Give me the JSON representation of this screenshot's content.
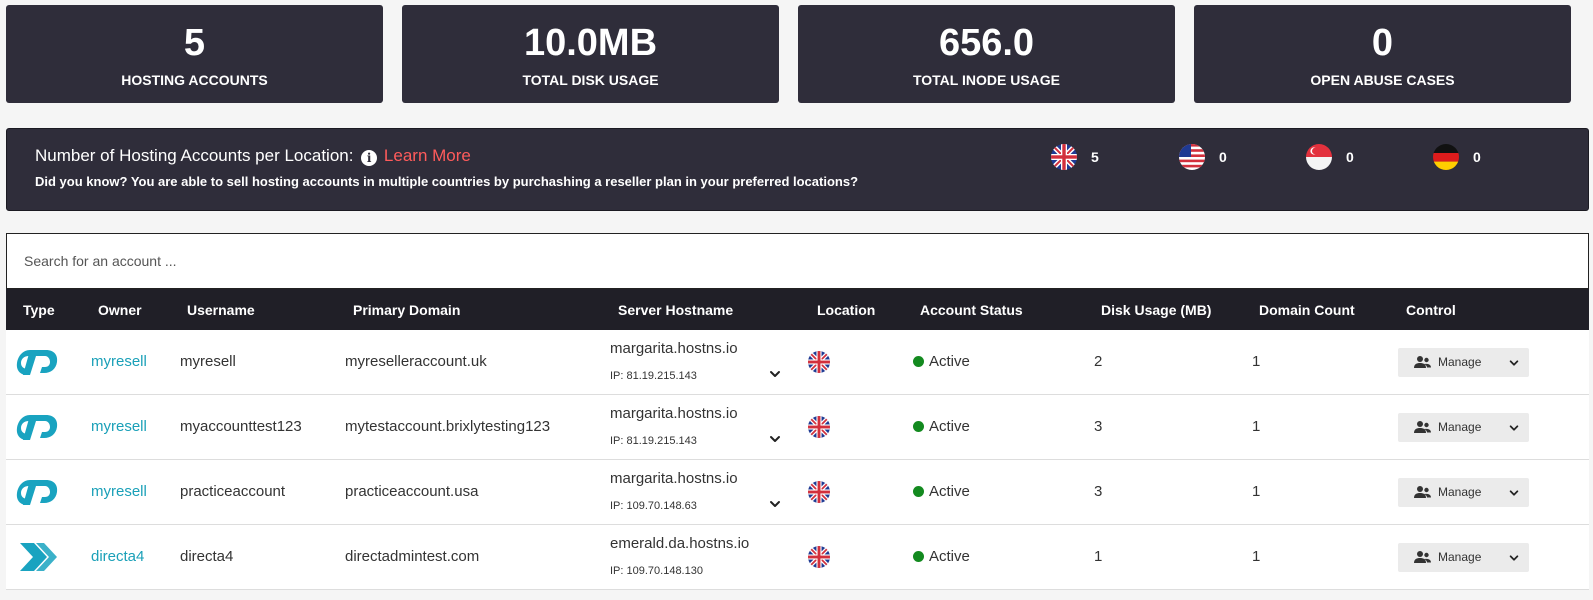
{
  "stats": [
    {
      "value": "5",
      "label": "HOSTING ACCOUNTS"
    },
    {
      "value": "10.0MB",
      "label": "TOTAL DISK USAGE"
    },
    {
      "value": "656.0",
      "label": "TOTAL INODE USAGE"
    },
    {
      "value": "0",
      "label": "OPEN ABUSE CASES"
    }
  ],
  "locations": {
    "title": "Number of Hosting Accounts per Location:",
    "learn_more": "Learn More",
    "subtitle": "Did you know? You are able to sell hosting accounts in multiple countries by purchashing a reseller plan in your preferred locations?",
    "flags": [
      {
        "icon": "uk-flag-icon",
        "count": "5"
      },
      {
        "icon": "us-flag-icon",
        "count": "0"
      },
      {
        "icon": "singapore-flag-icon",
        "count": "0"
      },
      {
        "icon": "germany-flag-icon",
        "count": "0"
      }
    ]
  },
  "search": {
    "placeholder": "Search for an account ..."
  },
  "table": {
    "headers": [
      "Type",
      "Owner",
      "Username",
      "Primary Domain",
      "Server Hostname",
      "Location",
      "Account Status",
      "Disk Usage (MB)",
      "Domain Count",
      "Control"
    ],
    "rows": [
      {
        "type_icon": "cpanel-icon",
        "owner": "myresell",
        "username": "myresell",
        "domain": "myreselleraccount.uk",
        "hostname": "margarita.hostns.io",
        "ip": "IP:  81.19.215.143",
        "location_icon": "uk-flag-icon",
        "status": "Active",
        "disk": "2",
        "domains": "1",
        "control": "Manage"
      },
      {
        "type_icon": "cpanel-icon",
        "owner": "myresell",
        "username": "myaccounttest123",
        "domain": "mytestaccount.brixlytesting123",
        "hostname": "margarita.hostns.io",
        "ip": "IP:  81.19.215.143",
        "location_icon": "uk-flag-icon",
        "status": "Active",
        "disk": "3",
        "domains": "1",
        "control": "Manage"
      },
      {
        "type_icon": "cpanel-icon",
        "owner": "myresell",
        "username": "practiceaccount",
        "domain": "practiceaccount.usa",
        "hostname": "margarita.hostns.io",
        "ip": "IP:  109.70.148.63",
        "location_icon": "uk-flag-icon",
        "status": "Active",
        "disk": "3",
        "domains": "1",
        "control": "Manage"
      },
      {
        "type_icon": "directadmin-icon",
        "owner": "directa4",
        "username": "directa4",
        "domain": "directadmintest.com",
        "hostname": "emerald.da.hostns.io",
        "ip": "IP: 109.70.148.130",
        "location_icon": "uk-flag-icon",
        "status": "Active",
        "disk": "1",
        "domains": "1",
        "control": "Manage"
      }
    ]
  },
  "colors": {
    "panel": "#2f2d3a",
    "header": "#201f27",
    "accent": "#1aa0b8",
    "link": "#ff5b5b",
    "active": "#138a1f"
  }
}
